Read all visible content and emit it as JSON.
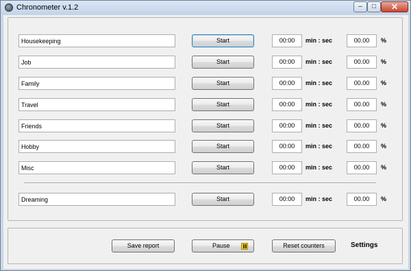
{
  "window": {
    "title": "Chronometer  v.1.2",
    "controls": {
      "minimize": "–",
      "maximize": "□",
      "close": "✕"
    }
  },
  "activities": [
    {
      "name": "Housekeeping",
      "button": "Start",
      "time": "00:00",
      "unit": "min : sec",
      "percent": "00.00",
      "pct_sign": "%"
    },
    {
      "name": "Job",
      "button": "Start",
      "time": "00:00",
      "unit": "min : sec",
      "percent": "00.00",
      "pct_sign": "%"
    },
    {
      "name": "Family",
      "button": "Start",
      "time": "00:00",
      "unit": "min : sec",
      "percent": "00.00",
      "pct_sign": "%"
    },
    {
      "name": "Travel",
      "button": "Start",
      "time": "00:00",
      "unit": "min : sec",
      "percent": "00.00",
      "pct_sign": "%"
    },
    {
      "name": "Friends",
      "button": "Start",
      "time": "00:00",
      "unit": "min : sec",
      "percent": "00.00",
      "pct_sign": "%"
    },
    {
      "name": "Hobby",
      "button": "Start",
      "time": "00:00",
      "unit": "min : sec",
      "percent": "00.00",
      "pct_sign": "%"
    },
    {
      "name": "Misc",
      "button": "Start",
      "time": "00:00",
      "unit": "min : sec",
      "percent": "00.00",
      "pct_sign": "%"
    }
  ],
  "dreaming": {
    "name": "Dreaming",
    "button": "Start",
    "time": "00:00",
    "unit": "min : sec",
    "percent": "00.00",
    "pct_sign": "%"
  },
  "footer": {
    "save_report": "Save report",
    "pause": "Pause",
    "reset_counters": "Reset counters",
    "settings": "Settings"
  },
  "icons": {
    "app": "stopwatch-icon",
    "pause": "pause-icon"
  },
  "colors": {
    "titlebar": "#c9d7e8",
    "close_button": "#c8452f",
    "pause_icon": "#e8c830",
    "focus_border": "#3c7fb1"
  }
}
